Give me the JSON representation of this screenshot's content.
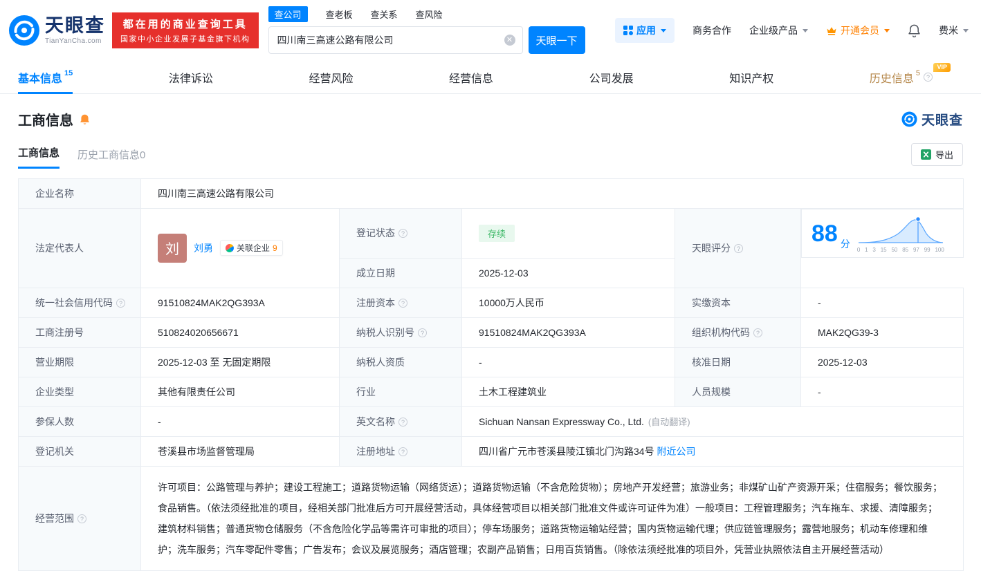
{
  "colors": {
    "brand_blue": "#0084ff",
    "logo_navy": "#15336c",
    "banner_red": "#e6302c",
    "vip_orange": "#ff9c00",
    "history_gold": "#b5874a",
    "status_green": "#42ba6b",
    "status_green_bg": "#e8f8ee",
    "label_bg": "#f7fafc",
    "table_border": "#e9edf2",
    "excel_green": "#21a366",
    "avatar_bg": "#c57f78",
    "related_count_orange": "#ff7d00"
  },
  "header": {
    "brand": "天眼查",
    "brand_domain": "TianYanCha.com",
    "banner_line1": "都在用的商业查询工具",
    "banner_line2": "国家中小企业发展子基金旗下机构",
    "search_tabs": [
      {
        "label": "查公司",
        "active": true
      },
      {
        "label": "查老板",
        "active": false
      },
      {
        "label": "查关系",
        "active": false
      },
      {
        "label": "查风险",
        "active": false
      }
    ],
    "search_value": "四川南三高速公路有限公司",
    "search_button_label": "天眼一下",
    "menu_apps": "应用",
    "menu_cooperation": "商务合作",
    "menu_enterprise": "企业级产品",
    "menu_vip": "开通会员",
    "menu_user": "费米"
  },
  "nav_tabs": [
    {
      "label": "基本信息",
      "count": "15"
    },
    {
      "label": "法律诉讼",
      "count": ""
    },
    {
      "label": "经营风险",
      "count": ""
    },
    {
      "label": "经营信息",
      "count": ""
    },
    {
      "label": "公司发展",
      "count": ""
    },
    {
      "label": "知识产权",
      "count": ""
    },
    {
      "label": "历史信息",
      "count": "5",
      "vip_badge": "VIP"
    }
  ],
  "section": {
    "title": "工商信息",
    "brand_watermark": "天眼查",
    "tab_current": "工商信息",
    "tab_history": "历史工商信息0",
    "export_label": "导出"
  },
  "info": {
    "company_name_label": "企业名称",
    "company_name": "四川南三高速公路有限公司",
    "legal_rep_label": "法定代表人",
    "legal_rep_avatar_char": "刘",
    "legal_rep_name": "刘勇",
    "related_companies_label": "关联企业",
    "related_companies_count": "9",
    "reg_status_label": "登记状态",
    "reg_status": "存续",
    "established_label": "成立日期",
    "established": "2025-12-03",
    "score_label": "天眼评分",
    "score_value": "88",
    "score_unit": "分",
    "score_axis": [
      "0",
      "1",
      "3",
      "15",
      "50",
      "85",
      "97",
      "99",
      "100"
    ],
    "credit_code_label": "统一社会信用代码",
    "credit_code": "91510824MAK2QG393A",
    "reg_capital_label": "注册资本",
    "reg_capital": "10000万人民币",
    "paid_capital_label": "实缴资本",
    "paid_capital": "-",
    "reg_no_label": "工商注册号",
    "reg_no": "510824020656671",
    "taxpayer_no_label": "纳税人识别号",
    "taxpayer_no": "91510824MAK2QG393A",
    "org_code_label": "组织机构代码",
    "org_code": "MAK2QG39-3",
    "term_label": "营业期限",
    "term": "2025-12-03 至 无固定期限",
    "taxpayer_quality_label": "纳税人资质",
    "taxpayer_quality": "-",
    "approved_label": "核准日期",
    "approved": "2025-12-03",
    "company_type_label": "企业类型",
    "company_type": "其他有限责任公司",
    "industry_label": "行业",
    "industry": "土木工程建筑业",
    "staff_label": "人员规模",
    "staff": "-",
    "insured_label": "参保人数",
    "insured": "-",
    "en_name_label": "英文名称",
    "en_name": "Sichuan Nansan Expressway Co., Ltd.",
    "en_name_note": "(自动翻译)",
    "authority_label": "登记机关",
    "authority": "苍溪县市场监督管理局",
    "address_label": "注册地址",
    "address": "四川省广元市苍溪县陵江镇北门沟路34号",
    "nearby_link": "附近公司",
    "scope_label": "经营范围",
    "scope": "许可项目：公路管理与养护；建设工程施工；道路货物运输（网络货运）；道路货物运输（不含危险货物）；房地产开发经营；旅游业务；非煤矿山矿产资源开采；住宿服务；餐饮服务；食品销售。（依法须经批准的项目，经相关部门批准后方可开展经营活动，具体经营项目以相关部门批准文件或许可证件为准）一般项目：工程管理服务；汽车拖车、求援、清障服务；建筑材料销售；普通货物仓储服务（不含危险化学品等需许可审批的项目）；停车场服务；道路货物运输站经营；国内货物运输代理；供应链管理服务；露营地服务；机动车修理和维护；洗车服务；汽车零配件零售；广告发布；会议及展览服务；酒店管理；农副产品销售；日用百货销售。（除依法须经批准的项目外，凭营业执照依法自主开展经营活动）"
  }
}
